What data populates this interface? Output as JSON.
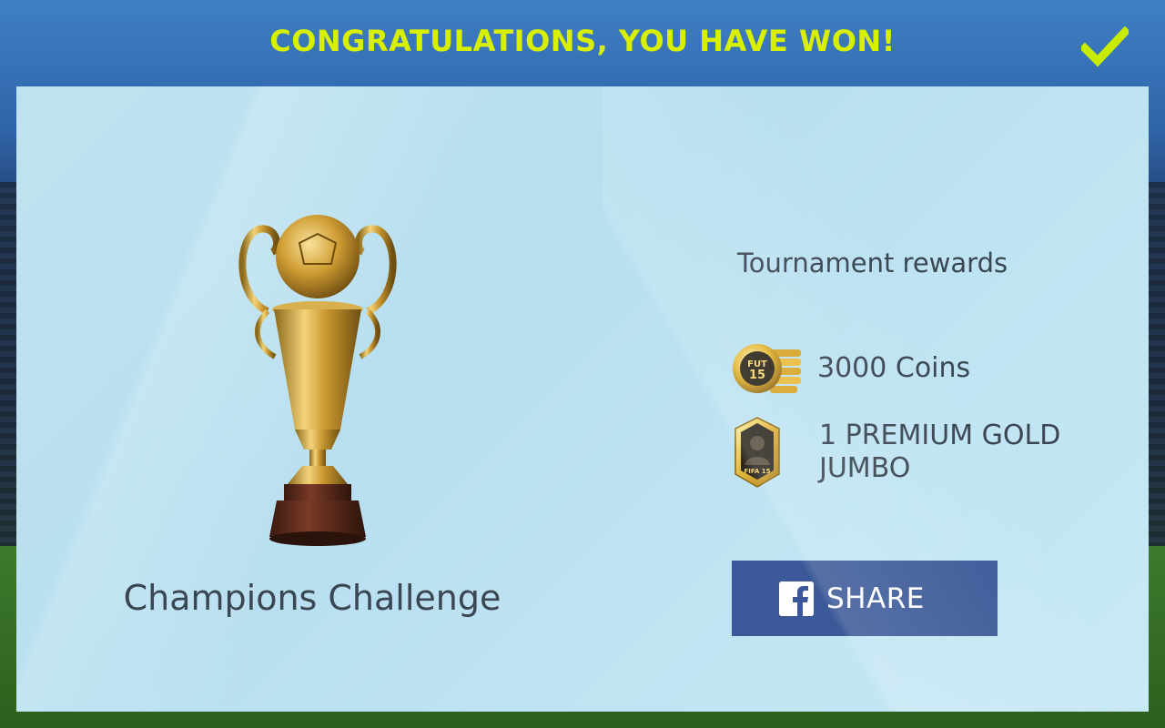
{
  "header": {
    "title": "CONGRATULATIONS, YOU HAVE WON!",
    "confirm_icon": "checkmark-icon"
  },
  "tournament": {
    "name": "Champions Challenge",
    "trophy_icon": "trophy-icon"
  },
  "rewards": {
    "heading": "Tournament rewards",
    "items": [
      {
        "icon": "coins-icon",
        "badge_text": "FUT 15",
        "label": "3000 Coins"
      },
      {
        "icon": "gold-pack-icon",
        "badge_text": "FIFA 15",
        "label": "1 PREMIUM GOLD JUMBO"
      }
    ]
  },
  "share": {
    "label": "SHARE",
    "icon": "facebook-icon",
    "color": "#3b5998"
  },
  "colors": {
    "accent": "#d8f000",
    "text": "#3a4652",
    "panel": "#bfe2f0"
  }
}
